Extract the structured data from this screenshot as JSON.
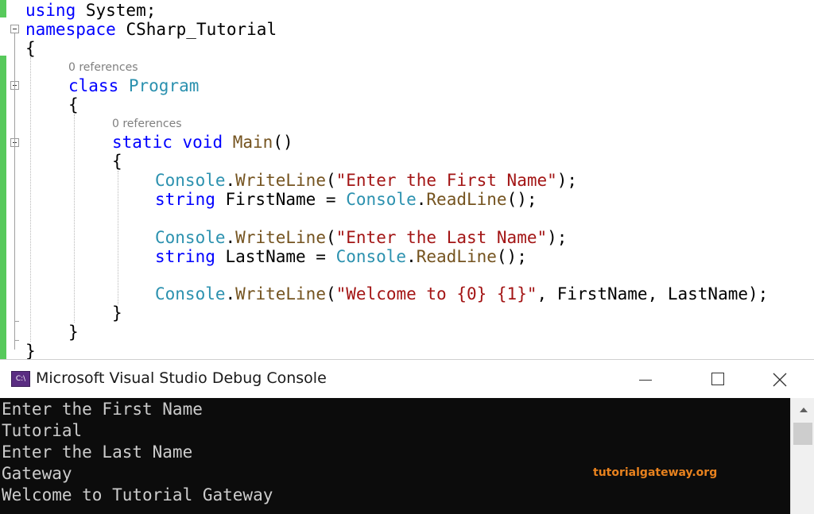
{
  "editor": {
    "lines": [
      "using System;",
      "namespace CSharp_Tutorial",
      "{",
      "class Program",
      "{",
      "static void Main()",
      "{",
      "Console.WriteLine(\"Enter the First Name\");",
      "string FirstName = Console.ReadLine();",
      "Console.WriteLine(\"Enter the Last Name\");",
      "string LastName = Console.ReadLine();",
      "Console.WriteLine(\"Welcome to {0} {1}\", FirstName, LastName);",
      "}",
      "}",
      "}"
    ],
    "codelens_class": "0 references",
    "codelens_main": "0 references"
  },
  "console": {
    "title": "Microsoft Visual Studio Debug Console",
    "icon_label": "C:\\",
    "output": [
      "Enter the First Name",
      "Tutorial",
      "Enter the Last Name",
      "Gateway",
      "Welcome to Tutorial Gateway"
    ],
    "watermark": "tutorialgateway.org"
  },
  "colors": {
    "keyword": "#0000ff",
    "type": "#2b91af",
    "string": "#a31515",
    "method": "#74531f",
    "change_bar": "#57c95b",
    "console_bg": "#0c0c0c",
    "watermark": "#e8821e"
  }
}
